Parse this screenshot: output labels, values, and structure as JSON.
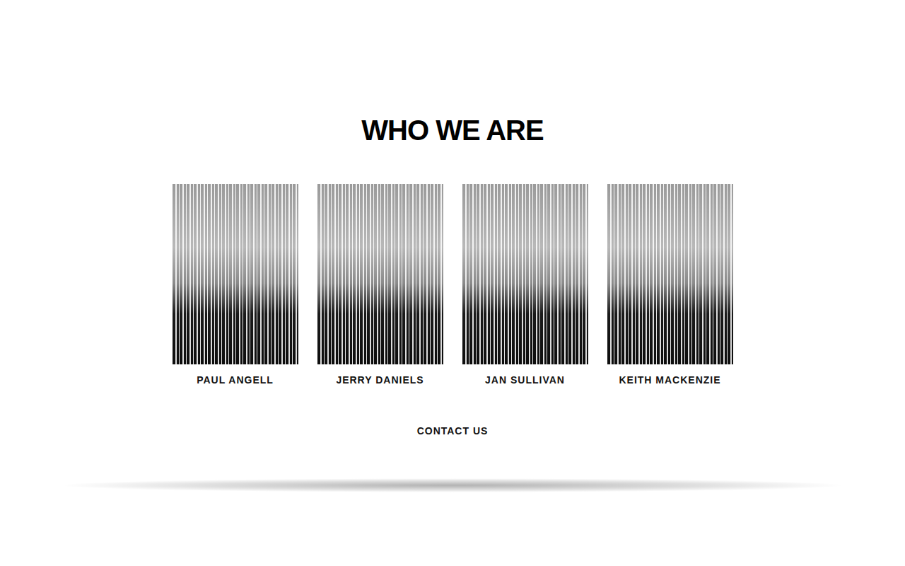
{
  "section": {
    "title": "WHO WE ARE"
  },
  "team": [
    {
      "name": "PAUL ANGELL"
    },
    {
      "name": "JERRY DANIELS"
    },
    {
      "name": "JAN SULLIVAN"
    },
    {
      "name": "KEITH MACKENZIE"
    }
  ],
  "contact": {
    "label": "CONTACT US"
  }
}
